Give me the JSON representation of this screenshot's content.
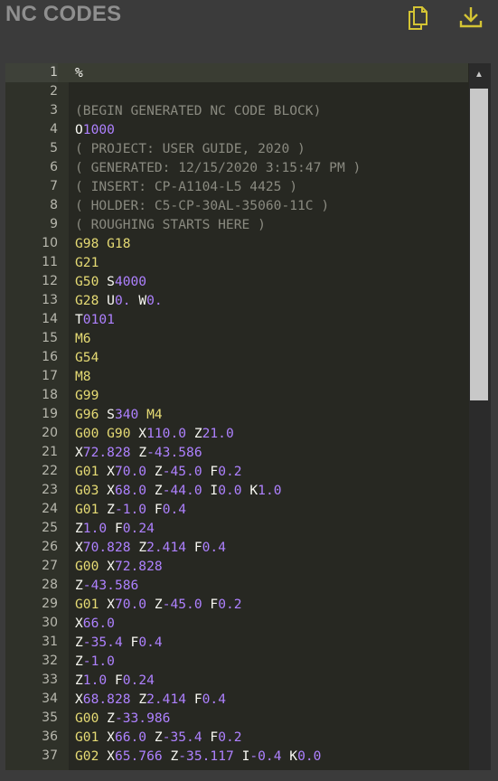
{
  "header": {
    "title": "NC CODES",
    "copy_icon": "copy-icon",
    "download_icon": "download-icon",
    "icon_color": "#d4c434"
  },
  "editor": {
    "active_line": 1,
    "lines": [
      {
        "n": "1",
        "t": [
          [
            "a",
            "%"
          ]
        ]
      },
      {
        "n": "2",
        "t": []
      },
      {
        "n": "3",
        "t": [
          [
            "c",
            "(BEGIN GENERATED NC CODE BLOCK)"
          ]
        ]
      },
      {
        "n": "4",
        "t": [
          [
            "a",
            "O"
          ],
          [
            "n",
            "1000"
          ]
        ]
      },
      {
        "n": "5",
        "t": [
          [
            "c",
            "( PROJECT: USER GUIDE, 2020 )"
          ]
        ]
      },
      {
        "n": "6",
        "t": [
          [
            "c",
            "( GENERATED: 12/15/2020 3:15:47 PM )"
          ]
        ]
      },
      {
        "n": "7",
        "t": [
          [
            "c",
            "( INSERT: CP-A1104-L5 4425 )"
          ]
        ]
      },
      {
        "n": "8",
        "t": [
          [
            "c",
            "( HOLDER: C5-CP-30AL-35060-11C )"
          ]
        ]
      },
      {
        "n": "9",
        "t": [
          [
            "c",
            "( ROUGHING STARTS HERE )"
          ]
        ]
      },
      {
        "n": "10",
        "t": [
          [
            "g",
            "G98 G18"
          ]
        ]
      },
      {
        "n": "11",
        "t": [
          [
            "g",
            "G21"
          ]
        ]
      },
      {
        "n": "12",
        "t": [
          [
            "g",
            "G50 "
          ],
          [
            "a",
            "S"
          ],
          [
            "n",
            "4000"
          ]
        ]
      },
      {
        "n": "13",
        "t": [
          [
            "g",
            "G28 "
          ],
          [
            "a",
            "U"
          ],
          [
            "n",
            "0. "
          ],
          [
            "a",
            "W"
          ],
          [
            "n",
            "0."
          ]
        ]
      },
      {
        "n": "14",
        "t": [
          [
            "a",
            "T"
          ],
          [
            "n",
            "0101"
          ]
        ]
      },
      {
        "n": "15",
        "t": [
          [
            "g",
            "M6"
          ]
        ]
      },
      {
        "n": "16",
        "t": [
          [
            "g",
            "G54"
          ]
        ]
      },
      {
        "n": "17",
        "t": [
          [
            "g",
            "M8"
          ]
        ]
      },
      {
        "n": "18",
        "t": [
          [
            "g",
            "G99"
          ]
        ]
      },
      {
        "n": "19",
        "t": [
          [
            "g",
            "G96 "
          ],
          [
            "a",
            "S"
          ],
          [
            "n",
            "340 "
          ],
          [
            "g",
            "M4"
          ]
        ]
      },
      {
        "n": "20",
        "t": [
          [
            "g",
            "G00 G90 "
          ],
          [
            "a",
            "X"
          ],
          [
            "n",
            "110.0 "
          ],
          [
            "a",
            "Z"
          ],
          [
            "n",
            "21.0"
          ]
        ]
      },
      {
        "n": "21",
        "t": [
          [
            "a",
            "X"
          ],
          [
            "n",
            "72.828 "
          ],
          [
            "a",
            "Z"
          ],
          [
            "n",
            "-43.586"
          ]
        ]
      },
      {
        "n": "22",
        "t": [
          [
            "g",
            "G01 "
          ],
          [
            "a",
            "X"
          ],
          [
            "n",
            "70.0 "
          ],
          [
            "a",
            "Z"
          ],
          [
            "n",
            "-45.0 "
          ],
          [
            "a",
            "F"
          ],
          [
            "n",
            "0.2"
          ]
        ]
      },
      {
        "n": "23",
        "t": [
          [
            "g",
            "G03 "
          ],
          [
            "a",
            "X"
          ],
          [
            "n",
            "68.0 "
          ],
          [
            "a",
            "Z"
          ],
          [
            "n",
            "-44.0 "
          ],
          [
            "a",
            "I"
          ],
          [
            "n",
            "0.0 "
          ],
          [
            "a",
            "K"
          ],
          [
            "n",
            "1.0"
          ]
        ]
      },
      {
        "n": "24",
        "t": [
          [
            "g",
            "G01 "
          ],
          [
            "a",
            "Z"
          ],
          [
            "n",
            "-1.0 "
          ],
          [
            "a",
            "F"
          ],
          [
            "n",
            "0.4"
          ]
        ]
      },
      {
        "n": "25",
        "t": [
          [
            "a",
            "Z"
          ],
          [
            "n",
            "1.0 "
          ],
          [
            "a",
            "F"
          ],
          [
            "n",
            "0.24"
          ]
        ]
      },
      {
        "n": "26",
        "t": [
          [
            "a",
            "X"
          ],
          [
            "n",
            "70.828 "
          ],
          [
            "a",
            "Z"
          ],
          [
            "n",
            "2.414 "
          ],
          [
            "a",
            "F"
          ],
          [
            "n",
            "0.4"
          ]
        ]
      },
      {
        "n": "27",
        "t": [
          [
            "g",
            "G00 "
          ],
          [
            "a",
            "X"
          ],
          [
            "n",
            "72.828"
          ]
        ]
      },
      {
        "n": "28",
        "t": [
          [
            "a",
            "Z"
          ],
          [
            "n",
            "-43.586"
          ]
        ]
      },
      {
        "n": "29",
        "t": [
          [
            "g",
            "G01 "
          ],
          [
            "a",
            "X"
          ],
          [
            "n",
            "70.0 "
          ],
          [
            "a",
            "Z"
          ],
          [
            "n",
            "-45.0 "
          ],
          [
            "a",
            "F"
          ],
          [
            "n",
            "0.2"
          ]
        ]
      },
      {
        "n": "30",
        "t": [
          [
            "a",
            "X"
          ],
          [
            "n",
            "66.0"
          ]
        ]
      },
      {
        "n": "31",
        "t": [
          [
            "a",
            "Z"
          ],
          [
            "n",
            "-35.4 "
          ],
          [
            "a",
            "F"
          ],
          [
            "n",
            "0.4"
          ]
        ]
      },
      {
        "n": "32",
        "t": [
          [
            "a",
            "Z"
          ],
          [
            "n",
            "-1.0"
          ]
        ]
      },
      {
        "n": "33",
        "t": [
          [
            "a",
            "Z"
          ],
          [
            "n",
            "1.0 "
          ],
          [
            "a",
            "F"
          ],
          [
            "n",
            "0.24"
          ]
        ]
      },
      {
        "n": "34",
        "t": [
          [
            "a",
            "X"
          ],
          [
            "n",
            "68.828 "
          ],
          [
            "a",
            "Z"
          ],
          [
            "n",
            "2.414 "
          ],
          [
            "a",
            "F"
          ],
          [
            "n",
            "0.4"
          ]
        ]
      },
      {
        "n": "35",
        "t": [
          [
            "g",
            "G00 "
          ],
          [
            "a",
            "Z"
          ],
          [
            "n",
            "-33.986"
          ]
        ]
      },
      {
        "n": "36",
        "t": [
          [
            "g",
            "G01 "
          ],
          [
            "a",
            "X"
          ],
          [
            "n",
            "66.0 "
          ],
          [
            "a",
            "Z"
          ],
          [
            "n",
            "-35.4 "
          ],
          [
            "a",
            "F"
          ],
          [
            "n",
            "0.2"
          ]
        ]
      },
      {
        "n": "37",
        "t": [
          [
            "g",
            "G02 "
          ],
          [
            "a",
            "X"
          ],
          [
            "n",
            "65.766 "
          ],
          [
            "a",
            "Z"
          ],
          [
            "n",
            "-35.117 "
          ],
          [
            "a",
            "I"
          ],
          [
            "n",
            "-0.4 "
          ],
          [
            "a",
            "K"
          ],
          [
            "n",
            "0.0"
          ]
        ]
      }
    ]
  }
}
